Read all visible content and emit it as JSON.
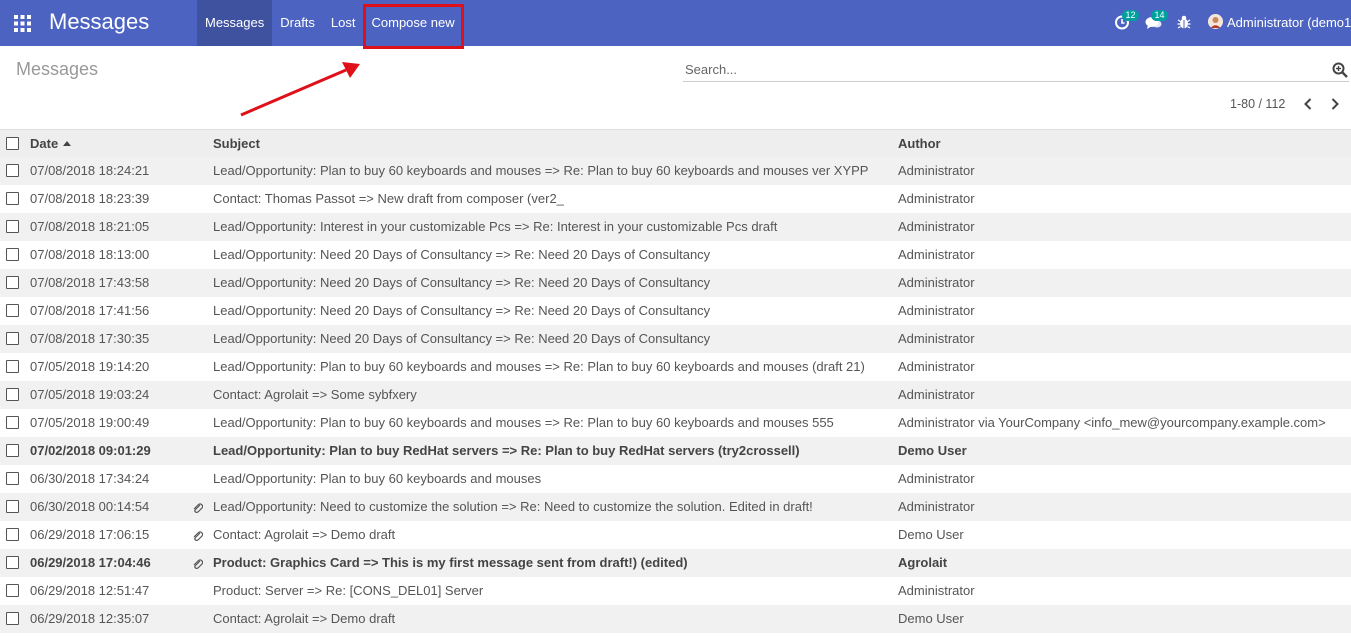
{
  "app": {
    "title": "Messages"
  },
  "nav": {
    "menu": [
      {
        "label": "Messages",
        "active": true
      },
      {
        "label": "Drafts",
        "active": false
      },
      {
        "label": "Lost",
        "active": false
      },
      {
        "label": "Compose new",
        "active": false
      }
    ]
  },
  "systray": {
    "activity_count": "12",
    "messages_count": "14",
    "user_label": "Administrator (demo1"
  },
  "control_panel": {
    "breadcrumb": "Messages",
    "search_placeholder": "Search...",
    "pager": "1-80 / 112"
  },
  "table": {
    "headers": {
      "date": "Date",
      "subject": "Subject",
      "author": "Author"
    },
    "rows": [
      {
        "date": "07/08/2018 18:24:21",
        "subject": "Lead/Opportunity: Plan to buy 60 keyboards and mouses => Re: Plan to buy 60 keyboards and mouses ver XYPP",
        "author": "Administrator",
        "attachment": false,
        "unread": false
      },
      {
        "date": "07/08/2018 18:23:39",
        "subject": "Contact: Thomas Passot => New draft from composer (ver2_",
        "author": "Administrator",
        "attachment": false,
        "unread": false
      },
      {
        "date": "07/08/2018 18:21:05",
        "subject": "Lead/Opportunity: Interest in your customizable Pcs => Re: Interest in your customizable Pcs draft",
        "author": "Administrator",
        "attachment": false,
        "unread": false
      },
      {
        "date": "07/08/2018 18:13:00",
        "subject": "Lead/Opportunity: Need 20 Days of Consultancy => Re: Need 20 Days of Consultancy",
        "author": "Administrator",
        "attachment": false,
        "unread": false
      },
      {
        "date": "07/08/2018 17:43:58",
        "subject": "Lead/Opportunity: Need 20 Days of Consultancy => Re: Need 20 Days of Consultancy",
        "author": "Administrator",
        "attachment": false,
        "unread": false
      },
      {
        "date": "07/08/2018 17:41:56",
        "subject": "Lead/Opportunity: Need 20 Days of Consultancy => Re: Need 20 Days of Consultancy",
        "author": "Administrator",
        "attachment": false,
        "unread": false
      },
      {
        "date": "07/08/2018 17:30:35",
        "subject": "Lead/Opportunity: Need 20 Days of Consultancy => Re: Need 20 Days of Consultancy",
        "author": "Administrator",
        "attachment": false,
        "unread": false
      },
      {
        "date": "07/05/2018 19:14:20",
        "subject": "Lead/Opportunity: Plan to buy 60 keyboards and mouses => Re: Plan to buy 60 keyboards and mouses (draft 21)",
        "author": "Administrator",
        "attachment": false,
        "unread": false
      },
      {
        "date": "07/05/2018 19:03:24",
        "subject": "Contact: Agrolait => Some sybfxery",
        "author": "Administrator",
        "attachment": false,
        "unread": false
      },
      {
        "date": "07/05/2018 19:00:49",
        "subject": "Lead/Opportunity: Plan to buy 60 keyboards and mouses => Re: Plan to buy 60 keyboards and mouses 555",
        "author": "Administrator via YourCompany <info_mew@yourcompany.example.com>",
        "attachment": false,
        "unread": false
      },
      {
        "date": "07/02/2018 09:01:29",
        "subject": "Lead/Opportunity: Plan to buy RedHat servers => Re: Plan to buy RedHat servers (try2crossell)",
        "author": "Demo User",
        "attachment": false,
        "unread": true
      },
      {
        "date": "06/30/2018 17:34:24",
        "subject": "Lead/Opportunity: Plan to buy 60 keyboards and mouses",
        "author": "Administrator",
        "attachment": false,
        "unread": false
      },
      {
        "date": "06/30/2018 00:14:54",
        "subject": "Lead/Opportunity: Need to customize the solution => Re: Need to customize the solution. Edited in draft!",
        "author": "Administrator",
        "attachment": true,
        "unread": false
      },
      {
        "date": "06/29/2018 17:06:15",
        "subject": "Contact: Agrolait => Demo draft",
        "author": "Demo User",
        "attachment": true,
        "unread": false
      },
      {
        "date": "06/29/2018 17:04:46",
        "subject": "Product: Graphics Card => This is my first message sent from draft!) (edited)",
        "author": "Agrolait",
        "attachment": true,
        "unread": true
      },
      {
        "date": "06/29/2018 12:51:47",
        "subject": "Product: Server => Re: [CONS_DEL01] Server",
        "author": "Administrator",
        "attachment": false,
        "unread": false
      },
      {
        "date": "06/29/2018 12:35:07",
        "subject": "Contact: Agrolait => Demo draft",
        "author": "Demo User",
        "attachment": false,
        "unread": false
      }
    ]
  },
  "colors": {
    "navbar": "#4c63c1",
    "highlight": "#e0101a",
    "badge": "#00a09d"
  }
}
